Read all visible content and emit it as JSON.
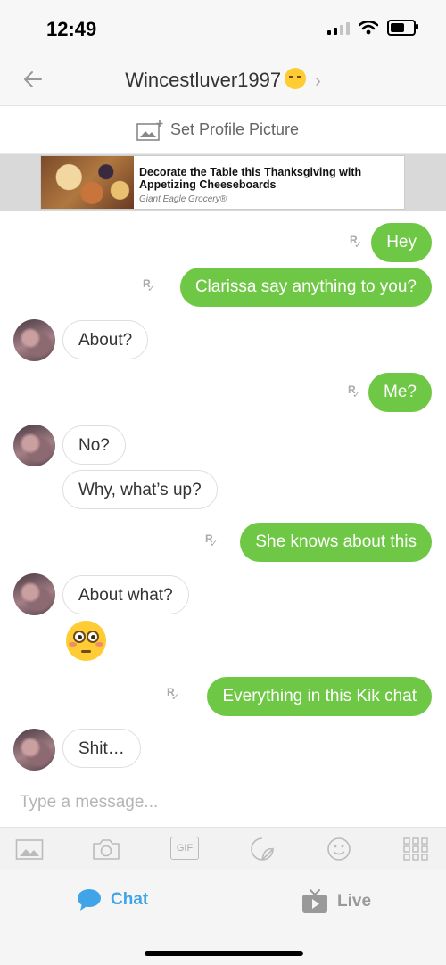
{
  "status_bar": {
    "time": "12:49",
    "battery_level": 0.75,
    "signal_bars": 2
  },
  "header": {
    "contact_name": "Wincestluver1997",
    "emoji": "smirking-face",
    "back_icon": "arrow-left-icon",
    "chevron_icon": "chevron-right-icon"
  },
  "profile": {
    "label": "Set Profile Picture",
    "icon": "add-picture-icon"
  },
  "ad": {
    "title": "Decorate the Table this Thanksgiving with Appetizing Cheeseboards",
    "sponsor": "Giant Eagle Grocery®"
  },
  "messages": [
    {
      "from": "me",
      "text": "Hey",
      "receipt": "R"
    },
    {
      "from": "me",
      "text": "Clarissa say anything to you?",
      "receipt": "R"
    },
    {
      "from": "them",
      "text": "About?"
    },
    {
      "from": "me",
      "text": "Me?",
      "receipt": "R"
    },
    {
      "from": "them",
      "text": "No?"
    },
    {
      "from": "them",
      "text": "Why, what’s up?"
    },
    {
      "from": "me",
      "text": "She knows about this",
      "receipt": "R"
    },
    {
      "from": "them",
      "text": "About what?"
    },
    {
      "from": "them",
      "emoji": "flushed-face"
    },
    {
      "from": "me",
      "text": "Everything in this Kik chat",
      "receipt": "R"
    },
    {
      "from": "them",
      "text": "Shit…"
    }
  ],
  "input": {
    "placeholder": "Type a message..."
  },
  "toolbar": {
    "gif_label": "GIF"
  },
  "nav": {
    "chat_label": "Chat",
    "live_label": "Live"
  },
  "colors": {
    "outgoing": "#6fc845",
    "accent": "#40a5e8"
  }
}
